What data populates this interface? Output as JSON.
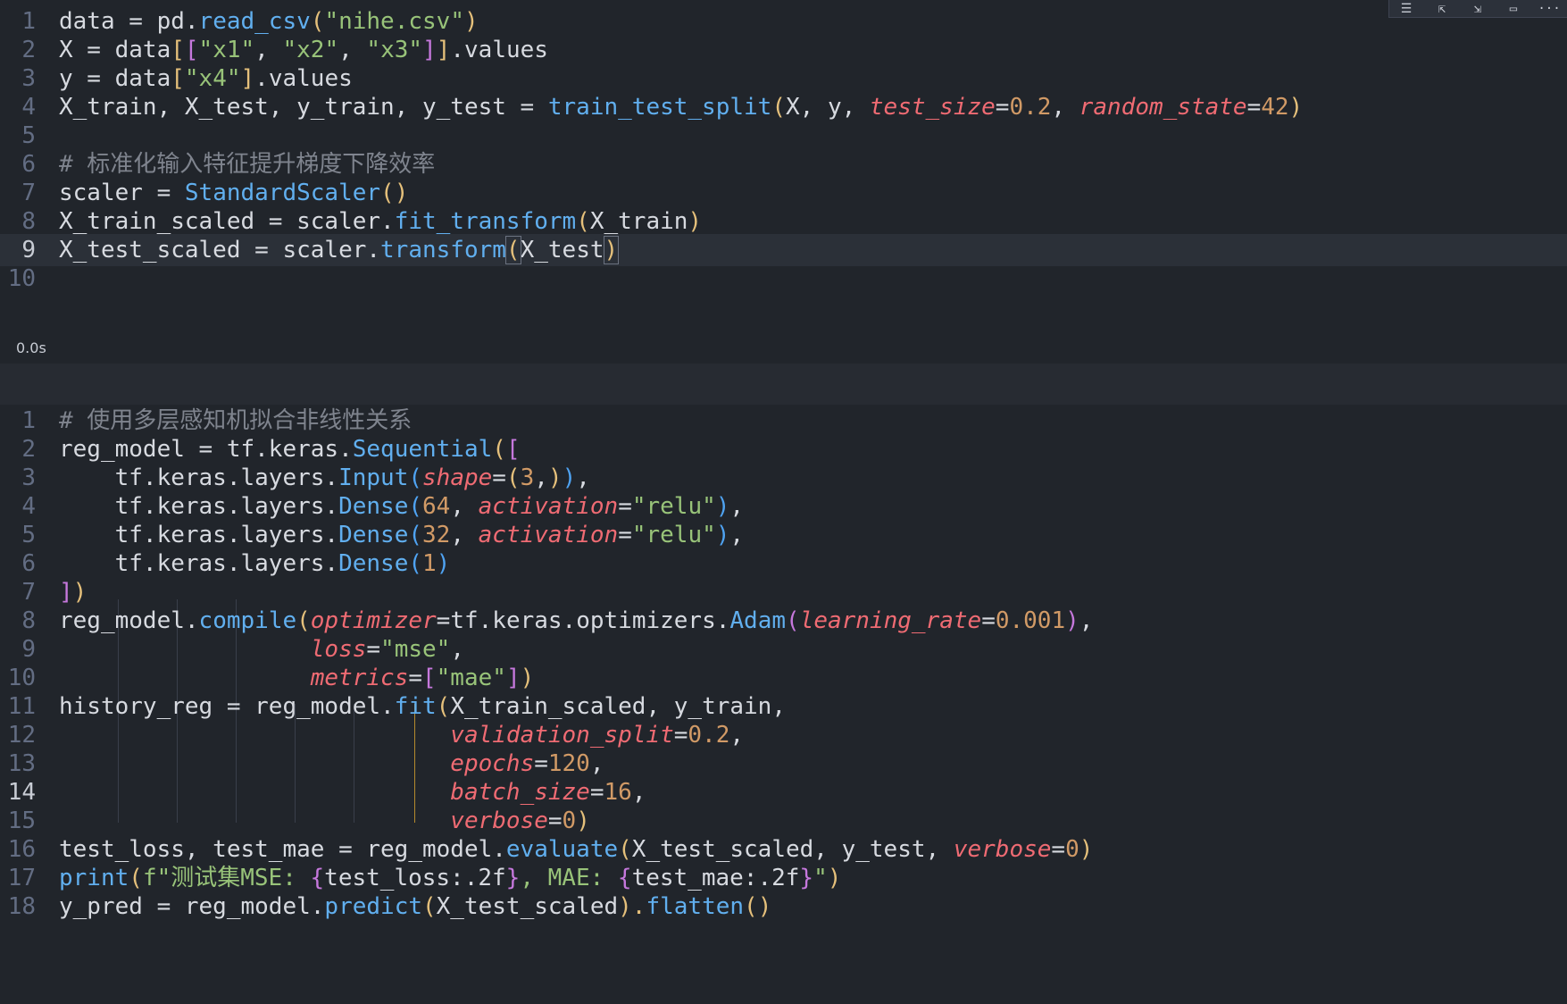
{
  "cell1": {
    "line_numbers": [
      "1",
      "2",
      "3",
      "4",
      "5",
      "6",
      "7",
      "8",
      "9",
      "10"
    ],
    "exec_time": "0.0s",
    "lines": {
      "l1": {
        "a": "data = pd.",
        "b": "read_csv",
        "c": "(",
        "d": "\"nihe.csv\"",
        "e": ")"
      },
      "l2": {
        "a": "X = data",
        "b": "[",
        "c": "[",
        "d": "\"x1\"",
        "e": ", ",
        "f": "\"x2\"",
        "g": ", ",
        "h": "\"x3\"",
        "i": "]",
        "j": "]",
        ".k": "",
        "k": ".values"
      },
      "l3": {
        "a": "y = data",
        "b": "[",
        "c": "\"x4\"",
        "d": "]",
        "e": ".values"
      },
      "l4": {
        "a": "X_train, X_test, y_train, y_test = ",
        "b": "train_test_split",
        "c": "(",
        "d": "X, y, ",
        "e": "test_size",
        "f": "=",
        "g": "0.2",
        "h": ", ",
        "i": "random_state",
        "j": "=",
        "k": "42",
        "l": ")"
      },
      "l6": {
        "a": "# 标准化输入特征提升梯度下降效率"
      },
      "l7": {
        "a": "scaler = ",
        "b": "StandardScaler",
        "c": "()"
      },
      "l8": {
        "a": "X_train_scaled = scaler.",
        "b": "fit_transform",
        "c": "(",
        "d": "X_train",
        "e": ")"
      },
      "l9": {
        "a": "X_test_scaled = scaler.",
        "b": "transform",
        "c": "(",
        "d": "X_test",
        "e": ")"
      }
    }
  },
  "cell2": {
    "line_numbers": [
      "1",
      "2",
      "3",
      "4",
      "5",
      "6",
      "7",
      "8",
      "9",
      "10",
      "11",
      "12",
      "13",
      "14",
      "15",
      "16",
      "17",
      "18"
    ],
    "lines": {
      "l1": {
        "a": "# 使用多层感知机拟合非线性关系"
      },
      "l2": {
        "a": "reg_model = tf.keras.",
        "b": "Sequential",
        "c": "(",
        "d": "["
      },
      "l3": {
        "a": "    tf.keras.layers.",
        "b": "Input",
        "c": "(",
        "d": "shape",
        "e": "=",
        "f": "(",
        "g": "3",
        "h": ",",
        "i": ")",
        "j": ")",
        ".k": "",
        "k": ","
      },
      "l4": {
        "a": "    tf.keras.layers.",
        "b": "Dense",
        "c": "(",
        "d": "64",
        "e": ", ",
        "f": "activation",
        "g": "=",
        "h": "\"relu\"",
        "i": ")",
        "j": ","
      },
      "l5": {
        "a": "    tf.keras.layers.",
        "b": "Dense",
        "c": "(",
        "d": "32",
        "e": ", ",
        "f": "activation",
        "g": "=",
        "h": "\"relu\"",
        "i": ")",
        "j": ","
      },
      "l6": {
        "a": "    tf.keras.layers.",
        "b": "Dense",
        "c": "(",
        "d": "1",
        "e": ")"
      },
      "l7": {
        "a": "]",
        "b": ")"
      },
      "l8": {
        "a": "reg_model.",
        "b": "compile",
        "c": "(",
        "d": "optimizer",
        "e": "=tf.keras.optimizers.",
        "f": "Adam",
        "g": "(",
        "h": "learning_rate",
        "i": "=",
        "j": "0.001",
        "k": ")",
        "l": ","
      },
      "l9": {
        "a": "                  ",
        "b": "loss",
        "c": "=",
        "d": "\"mse\"",
        "e": ","
      },
      "l10": {
        "a": "                  ",
        "b": "metrics",
        "c": "=",
        "d": "[",
        "e": "\"mae\"",
        "f": "]",
        "g": ")"
      },
      "l11": {
        "a": "history_reg = reg_model.",
        "b": "fit",
        "c": "(",
        "d": "X_train_scaled, y_train,"
      },
      "l12": {
        "a": "                            ",
        "b": "validation_split",
        "c": "=",
        "d": "0.2",
        "e": ","
      },
      "l13": {
        "a": "                            ",
        "b": "epochs",
        "c": "=",
        "d": "120",
        "e": ","
      },
      "l14": {
        "a": "                            ",
        "b": "batch_size",
        "c": "=",
        "d": "16",
        "e": ","
      },
      "l15": {
        "a": "                            ",
        "b": "verbose",
        "c": "=",
        "d": "0",
        "e": ")"
      },
      "l16": {
        "a": "test_loss, test_mae = reg_model.",
        "b": "evaluate",
        "c": "(",
        "d": "X_test_scaled, y_test, ",
        "e": "verbose",
        "f": "=",
        "g": "0",
        "h": ")"
      },
      "l17": {
        "a": "print",
        "b": "(",
        "c": "f\"测试集MSE: ",
        "d": "{",
        "e": "test_loss:.2f",
        "f": "}",
        "g": ", MAE: ",
        "h": "{",
        "i": "test_mae:.2f",
        "j": "}",
        "k": "\"",
        "l": ")"
      },
      "l18": {
        "a": "y_pred = reg_model.",
        "b": "predict",
        "c": "(",
        "d": "X_test_scaled",
        "e": ").",
        "f": "flatten",
        "g": "()"
      }
    }
  },
  "toolbar": {
    "icons": [
      "list-icon",
      "run-above-icon",
      "run-below-icon",
      "split-cell-icon",
      "more-icon"
    ],
    "more_label": "···"
  },
  "colors": {
    "background": "#21252b",
    "function": "#61afef",
    "string": "#98c379",
    "number": "#d19a66",
    "keyword_arg": "#ef6b73",
    "comment": "#7f848e"
  }
}
